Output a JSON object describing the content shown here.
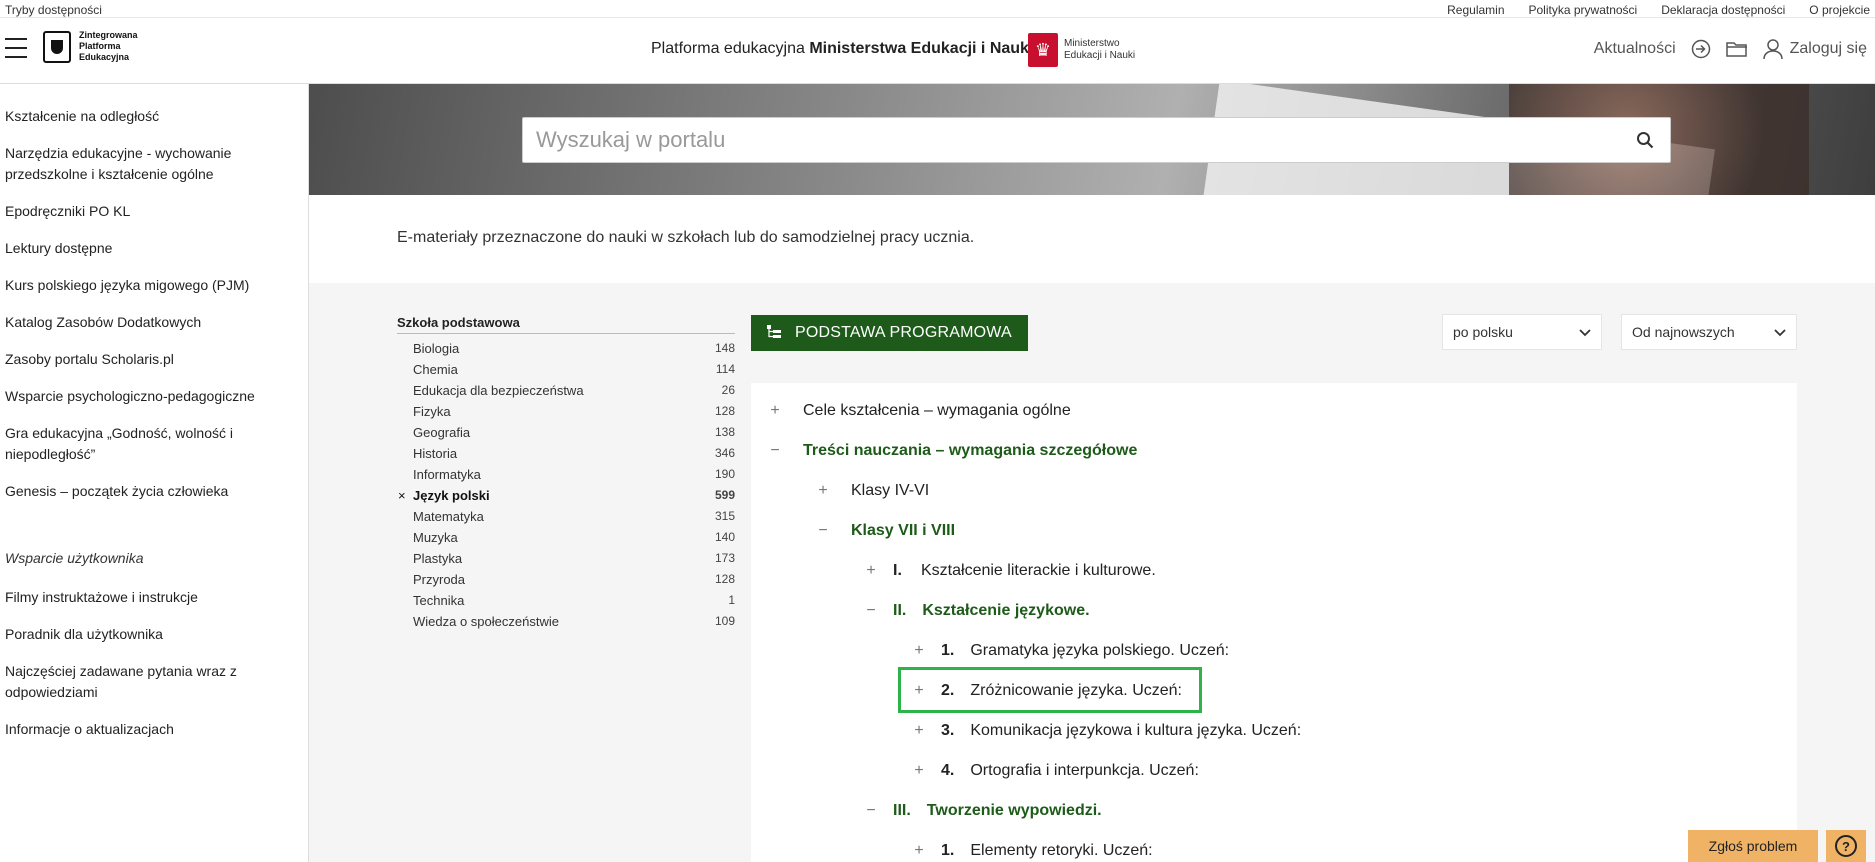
{
  "topbar": {
    "accessibility": "Tryby dostępności",
    "links": [
      "Regulamin",
      "Polityka prywatności",
      "Deklaracja dostępności",
      "O projekcie"
    ]
  },
  "header": {
    "logo_lines": [
      "Zintegrowana",
      "Platforma",
      "Edukacyjna"
    ],
    "title_prefix": "Platforma edukacyjna ",
    "title_bold": "Ministerstwa Edukacji i Nauki",
    "ministry_lines": [
      "Ministerstwo",
      "Edukacji i Nauki"
    ],
    "news": "Aktualności",
    "login": "Zaloguj się"
  },
  "sidebar": {
    "items": [
      "Kształcenie na odległość",
      "Narzędzia edukacyjne - wychowanie przedszkolne i kształcenie ogólne",
      "Epodręczniki PO KL",
      "Lektury dostępne",
      "Kurs polskiego języka migowego (PJM)",
      "Katalog Zasobów Dodatkowych",
      "Zasoby portalu Scholaris.pl",
      "Wsparcie psychologiczno-pedagogiczne",
      "Gra edukacyjna „Godność, wolność i niepodległość”",
      "Genesis – początek życia człowieka"
    ],
    "support_title": "Wsparcie użytkownika",
    "support_items": [
      "Filmy instruktażowe i instrukcje",
      "Poradnik dla użytkownika",
      "Najczęściej zadawane pytania wraz z odpowiedziami",
      "Informacje o aktualizacjach"
    ]
  },
  "search": {
    "placeholder": "Wyszukaj w portalu"
  },
  "intro": "E-materiały przeznaczone do nauki w szkołach lub do samodzielnej pracy ucznia.",
  "filter": {
    "title": "Szkoła podstawowa",
    "subjects": [
      {
        "name": "Biologia",
        "count": "148"
      },
      {
        "name": "Chemia",
        "count": "114"
      },
      {
        "name": "Edukacja dla bezpieczeństwa",
        "count": "26"
      },
      {
        "name": "Fizyka",
        "count": "128"
      },
      {
        "name": "Geografia",
        "count": "138"
      },
      {
        "name": "Historia",
        "count": "346"
      },
      {
        "name": "Informatyka",
        "count": "190"
      },
      {
        "name": "Język polski",
        "count": "599",
        "active": true
      },
      {
        "name": "Matematyka",
        "count": "315"
      },
      {
        "name": "Muzyka",
        "count": "140"
      },
      {
        "name": "Plastyka",
        "count": "173"
      },
      {
        "name": "Przyroda",
        "count": "128"
      },
      {
        "name": "Technika",
        "count": "1"
      },
      {
        "name": "Wiedza o społeczeństwie",
        "count": "109"
      }
    ]
  },
  "toolbar": {
    "pp_button": "PODSTAWA PROGRAMOWA",
    "lang_select": "po polsku",
    "sort_select": "Od najnowszych"
  },
  "tree": [
    {
      "level": 0,
      "toggle": "+",
      "num": "",
      "label": "Cele kształcenia – wymagania ogólne",
      "open": false
    },
    {
      "level": 0,
      "toggle": "−",
      "num": "",
      "label": "Treści nauczania – wymagania szczegółowe",
      "open": true
    },
    {
      "level": 1,
      "toggle": "+",
      "num": "",
      "label": "Klasy IV-VI",
      "open": false
    },
    {
      "level": 1,
      "toggle": "−",
      "num": "",
      "label": "Klasy VII i VIII",
      "open": true
    },
    {
      "level": 2,
      "toggle": "+",
      "num": "I.",
      "label": "Kształcenie literackie i kulturowe.",
      "open": false
    },
    {
      "level": 2,
      "toggle": "−",
      "num": "II.",
      "label": "Kształcenie językowe.",
      "open": true
    },
    {
      "level": 3,
      "toggle": "+",
      "num": "1.",
      "label": "Gramatyka języka polskiego. Uczeń:",
      "open": false
    },
    {
      "level": 3,
      "toggle": "+",
      "num": "2.",
      "label": "Zróżnicowanie języka. Uczeń:",
      "open": false
    },
    {
      "level": 3,
      "toggle": "+",
      "num": "3.",
      "label": "Komunikacja językowa i kultura języka. Uczeń:",
      "open": false
    },
    {
      "level": 3,
      "toggle": "+",
      "num": "4.",
      "label": "Ortografia i interpunkcja. Uczeń:",
      "open": false
    },
    {
      "level": 2,
      "toggle": "−",
      "num": "III.",
      "label": "Tworzenie wypowiedzi.",
      "open": true
    },
    {
      "level": 3,
      "toggle": "+",
      "num": "1.",
      "label": "Elementy retoryki. Uczeń:",
      "open": false
    }
  ],
  "floating": {
    "report": "Zgłoś problem",
    "help": "?"
  },
  "colors": {
    "accent_green": "#1e5b1a",
    "highlight": "#2db34a",
    "report_bg": "#f0b366"
  }
}
